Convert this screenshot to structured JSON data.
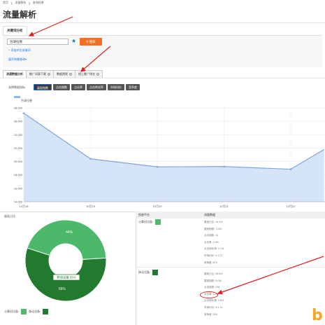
{
  "breadcrumb": {
    "items": [
      "首页",
      "流量解析",
      "查询结果"
    ],
    "separator": "❯"
  },
  "page": {
    "title": "流量解析"
  },
  "keyword_tab": {
    "label": "关键词分析"
  },
  "search": {
    "input_value": "台球拉厘",
    "button_label": "搜索",
    "search_icon": "search-icon",
    "star_icon": "star-icon",
    "add_compare_label": "添加对比关键词",
    "expand_label": "展开快捷查询"
  },
  "subtabs": [
    {
      "label": "流通数据分析",
      "help": ""
    },
    {
      "label": "推广词表下载",
      "help": "?"
    },
    {
      "label": "数据透视",
      "help": "?"
    },
    {
      "label": "线上推广排名",
      "help": "?"
    }
  ],
  "metrics": {
    "label": "选择数据指标:",
    "buttons": [
      "展现指数",
      "点击指数",
      "点击率",
      "点击转化率",
      "市场均价",
      "竞争度"
    ]
  },
  "chart_legend": {
    "series_name": "台球拉厘"
  },
  "chart_data": {
    "type": "area",
    "categories": [
      "12月18",
      "12月19",
      "12月20",
      "12月21",
      "12月22"
    ],
    "series": [
      {
        "name": "台球拉厘",
        "x": [
          0,
          1,
          2,
          3,
          4,
          4.5
        ],
        "values": [
          27200,
          20400,
          19200,
          19250,
          18850,
          21800
        ]
      }
    ],
    "y_ticks": [
      "28,000",
      "26,000",
      "24,000",
      "22,000",
      "20,000",
      "18,000",
      "16,000",
      "14,000"
    ],
    "ylim": [
      14000,
      28000
    ],
    "grid": true,
    "colors": {
      "line": "#7ea6e0",
      "fill": "#cfdff6"
    }
  },
  "pie": {
    "title": "展现占比:",
    "slices": [
      {
        "name": "计算机设备",
        "percent": 44,
        "label": "44%",
        "color": "#4cb86a"
      },
      {
        "name": "移动设备",
        "percent": 56,
        "label": "56%",
        "color": "#217a2e"
      }
    ],
    "tooltip": "移动设备 56%",
    "legend": [
      "计算机设备:",
      "移动设备:"
    ]
  },
  "right_panel": {
    "headers": [
      "投放平台",
      "流量数据"
    ],
    "platforms": [
      {
        "name": "计算机设备:",
        "color": "#4cb86a",
        "stats": [
          {
            "label": "展现占比:",
            "value": "44.4%"
          },
          {
            "label": "展现指数:",
            "value": "7,240"
          },
          {
            "label": "点击指数:",
            "value": "41"
          },
          {
            "label": "点击率:",
            "value": "0.5%"
          },
          {
            "label": "点击转化率:",
            "value": "2.1%"
          },
          {
            "label": "市场均价:",
            "value": "¥ 1.22"
          },
          {
            "label": "竞争度:",
            "value": "673"
          }
        ]
      },
      {
        "name": "移动设备:",
        "color": "#217a2e",
        "stats": [
          {
            "label": "展现占比:",
            "value": "55.6%"
          },
          {
            "label": "展现指数:",
            "value": "9,040"
          },
          {
            "label": "点击指数:",
            "value": "338"
          },
          {
            "label": "点击率:",
            "value": "3.4%"
          },
          {
            "label": "点击转化率:",
            "value": "0.8%"
          },
          {
            "label": "市场均价:",
            "value": "¥ 1.13"
          },
          {
            "label": "竞争度:",
            "value": "594"
          }
        ]
      }
    ]
  },
  "watermark": {
    "text": "b",
    "color": "#f5a623"
  },
  "annotation_color": "#e02020"
}
